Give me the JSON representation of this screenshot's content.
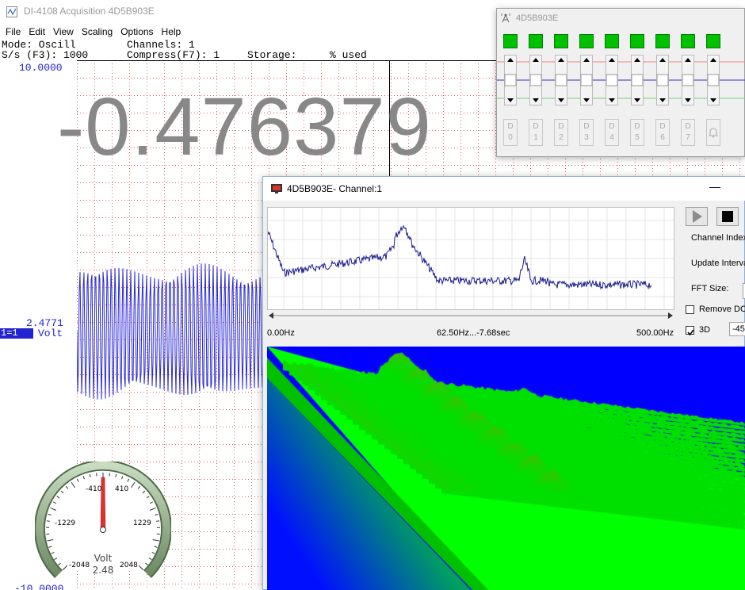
{
  "main": {
    "title": "DI-4108 Acquisition 4D5B903E",
    "menu": [
      "File",
      "Edit",
      "View",
      "Scaling",
      "Options",
      "Help"
    ],
    "status": {
      "mode": "Mode: Oscill",
      "channels": "Channels: 1",
      "rate": "S/s (F3): 1000",
      "compress": "Compress(F7): 1",
      "storage": "Storage:",
      "used": "% used"
    },
    "axis": {
      "top": "10.0000",
      "mid": "2.4771",
      "bottom": "-10.0000"
    },
    "channel_tag": "1=1",
    "channel_unit": "Volt",
    "readout": "-0.476379"
  },
  "gauge": {
    "ticks": [
      "-410",
      "410",
      "-1229",
      "1229",
      "-2048",
      "2048"
    ],
    "unit": "Volt",
    "value": "2.48"
  },
  "dio": {
    "title": "4D5B903E",
    "buttons": [
      {
        "top": "D",
        "bottom": "0"
      },
      {
        "top": "D",
        "bottom": "1"
      },
      {
        "top": "D",
        "bottom": "2"
      },
      {
        "top": "D",
        "bottom": "3"
      },
      {
        "top": "D",
        "bottom": "4"
      },
      {
        "top": "D",
        "bottom": "5"
      },
      {
        "top": "D",
        "bottom": "6"
      },
      {
        "top": "D",
        "bottom": "7"
      }
    ],
    "colors": {
      "led_on": "#00c000"
    }
  },
  "fft": {
    "title": "4D5B903E- Channel:1",
    "freq_left": "0.00Hz",
    "freq_mid": "62.50Hz...-7.68sec",
    "freq_right": "500.00Hz",
    "labels": {
      "channel_index": "Channel Index",
      "update_interval": "Update Interva",
      "fft_size": "FFT Size:",
      "remove_dc": "Remove DC",
      "three_d": "3D",
      "angle": "-45"
    },
    "colors": {
      "spectrum_bg": "#0000ff",
      "surface_low": "#00e000",
      "surface_high": "#c03000"
    }
  }
}
